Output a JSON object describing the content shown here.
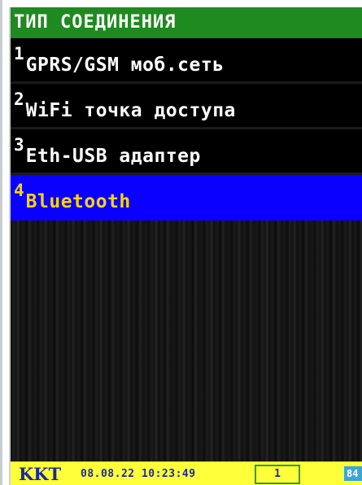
{
  "title": "ТИП СОЕДИНЕНИЯ",
  "menu": {
    "items": [
      {
        "num": "1",
        "label": "GPRS/GSM моб.сеть"
      },
      {
        "num": "2",
        "label": "WiFi точка доступа"
      },
      {
        "num": "3",
        "label": "Eth-USB адаптер"
      },
      {
        "num": "4",
        "label": "Bluetooth"
      }
    ],
    "selected_index": 3
  },
  "status": {
    "device": "KKT",
    "datetime": "08.08.22 10:23:49",
    "counter": "1",
    "battery": "84"
  },
  "colors": {
    "title_bg": "#1f8a1f",
    "selected_bg": "#0a00ff",
    "selected_text": "#ffd400",
    "status_bg": "#ffff3a",
    "status_text": "#1a2aa0"
  }
}
